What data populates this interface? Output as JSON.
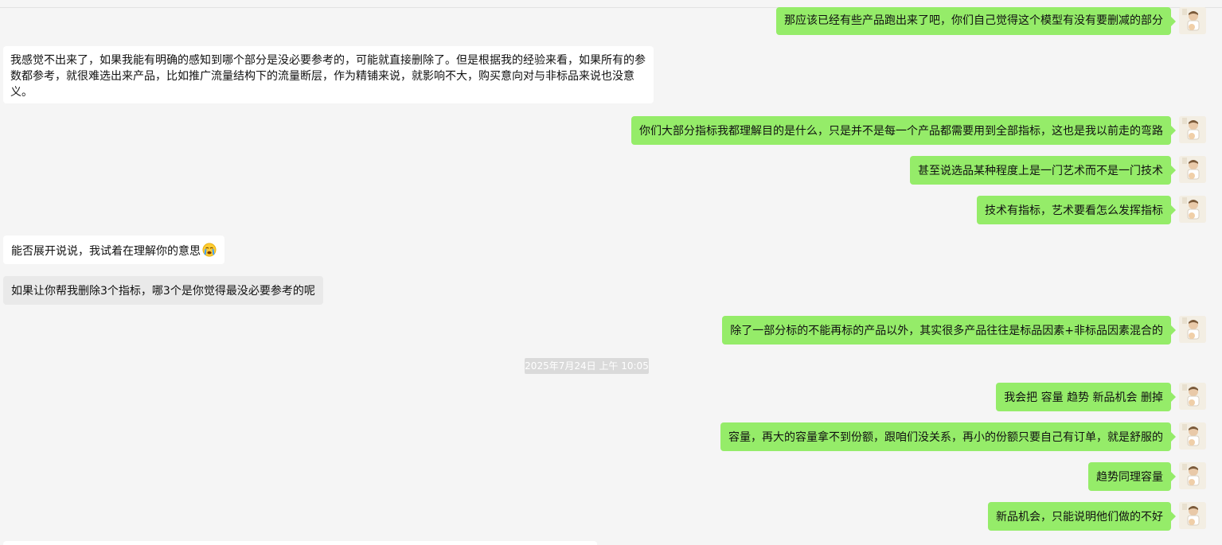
{
  "chat": {
    "timestamp": "2025年7月24日 上午 10:05",
    "messages": [
      {
        "side": "right",
        "text": "那应该已经有些产品跑出来了吧，你们自己觉得这个模型有没有要删减的部分"
      },
      {
        "side": "left",
        "style": "white",
        "text": "我感觉不出来了，如果我能有明确的感知到哪个部分是没必要参考的，可能就直接删除了。但是根据我的经验来看，如果所有的参数都参考，就很难选出来产品，比如推广流量结构下的流量断层，作为精铺来说，就影响不大，购买意向对与非标品来说也没意义。"
      },
      {
        "side": "right",
        "text": "你们大部分指标我都理解目的是什么，只是并不是每一个产品都需要用到全部指标，这也是我以前走的弯路"
      },
      {
        "side": "right",
        "text": "甚至说选品某种程度上是一门艺术而不是一门技术"
      },
      {
        "side": "right",
        "text": "技术有指标，艺术要看怎么发挥指标"
      },
      {
        "side": "left",
        "style": "white",
        "text": "能否展开说说，我试着在理解你的意思",
        "emoji": "crying-emoji"
      },
      {
        "side": "left",
        "style": "grey",
        "text": "如果让你帮我删除3个指标，哪3个是你觉得最没必要参考的呢"
      },
      {
        "side": "right",
        "text": "除了一部分标的不能再标的产品以外，其实很多产品往往是标品因素+非标品因素混合的"
      },
      {
        "side": "right",
        "text": "我会把 容量 趋势 新品机会 删掉"
      },
      {
        "side": "right",
        "text": "容量，再大的容量拿不到份额，跟咱们没关系，再小的份额只要自己有订单，就是舒服的"
      },
      {
        "side": "right",
        "text": "趋势同理容量"
      },
      {
        "side": "right",
        "text": "新品机会，只能说明他们做的不好"
      }
    ]
  },
  "colors": {
    "background": "#f5f5f5",
    "outgoing_bubble": "#95ec69",
    "incoming_bubble": "#ffffff",
    "selected_bubble": "#e9e9e9",
    "timestamp_bg": "#dadada"
  }
}
